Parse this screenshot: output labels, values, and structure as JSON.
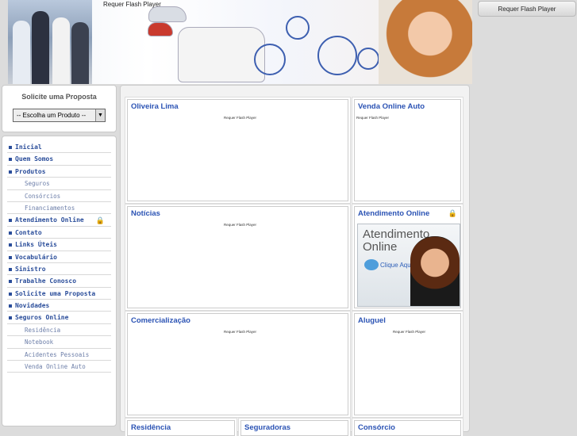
{
  "banner": {
    "flash_notice": "Requer Flash Player"
  },
  "top_right": {
    "flash_notice": "Requer Flash Player"
  },
  "proposal": {
    "title": "Solicite uma Proposta",
    "select_value": "-- Escolha um Produto --"
  },
  "menu": {
    "items": [
      {
        "label": "Inicial",
        "level": "top"
      },
      {
        "label": "Quem Somos",
        "level": "top"
      },
      {
        "label": "Produtos",
        "level": "top"
      },
      {
        "label": "Seguros",
        "level": "sub"
      },
      {
        "label": "Consórcios",
        "level": "sub"
      },
      {
        "label": "Financiamentos",
        "level": "sub"
      },
      {
        "label": "Atendimento Online",
        "level": "top",
        "icon": "lock-icon"
      },
      {
        "label": "Contato",
        "level": "top"
      },
      {
        "label": "Links Úteis",
        "level": "top"
      },
      {
        "label": "Vocabulário",
        "level": "top"
      },
      {
        "label": "Sinistro",
        "level": "top"
      },
      {
        "label": "Trabalhe Conosco",
        "level": "top"
      },
      {
        "label": "Solicite uma Proposta",
        "level": "top"
      },
      {
        "label": "Novidades",
        "level": "top"
      },
      {
        "label": "Seguros Online",
        "level": "top"
      },
      {
        "label": "Residência",
        "level": "sub"
      },
      {
        "label": "Notebook",
        "level": "sub"
      },
      {
        "label": "Acidentes Pessoais",
        "level": "sub"
      },
      {
        "label": "Venda Online Auto",
        "level": "sub"
      }
    ]
  },
  "boxes": {
    "oliveira": {
      "title": "Oliveira Lima",
      "flash": "Requer Flash Player"
    },
    "venda": {
      "title": "Venda Online Auto",
      "flash": "Requer Flash Player"
    },
    "noticias": {
      "title": "Notícias",
      "flash": "Requer Flash Player"
    },
    "atendimento": {
      "title": "Atendimento Online",
      "ad_title": "Atendimento Online",
      "ad_cta": "Clique Aqui!"
    },
    "comercializacao": {
      "title": "Comercialização",
      "flash": "Requer Flash Player"
    },
    "aluguel": {
      "title": "Aluguel",
      "flash": "Requer Flash Player"
    },
    "residencia": {
      "title": "Residência"
    },
    "seguradoras": {
      "title": "Seguradoras"
    },
    "consorcio": {
      "title": "Consórcio"
    }
  },
  "colors": {
    "link_blue": "#2b53b4",
    "menu_blue": "#2a4d9a",
    "sub_menu": "#6c7ea8"
  }
}
